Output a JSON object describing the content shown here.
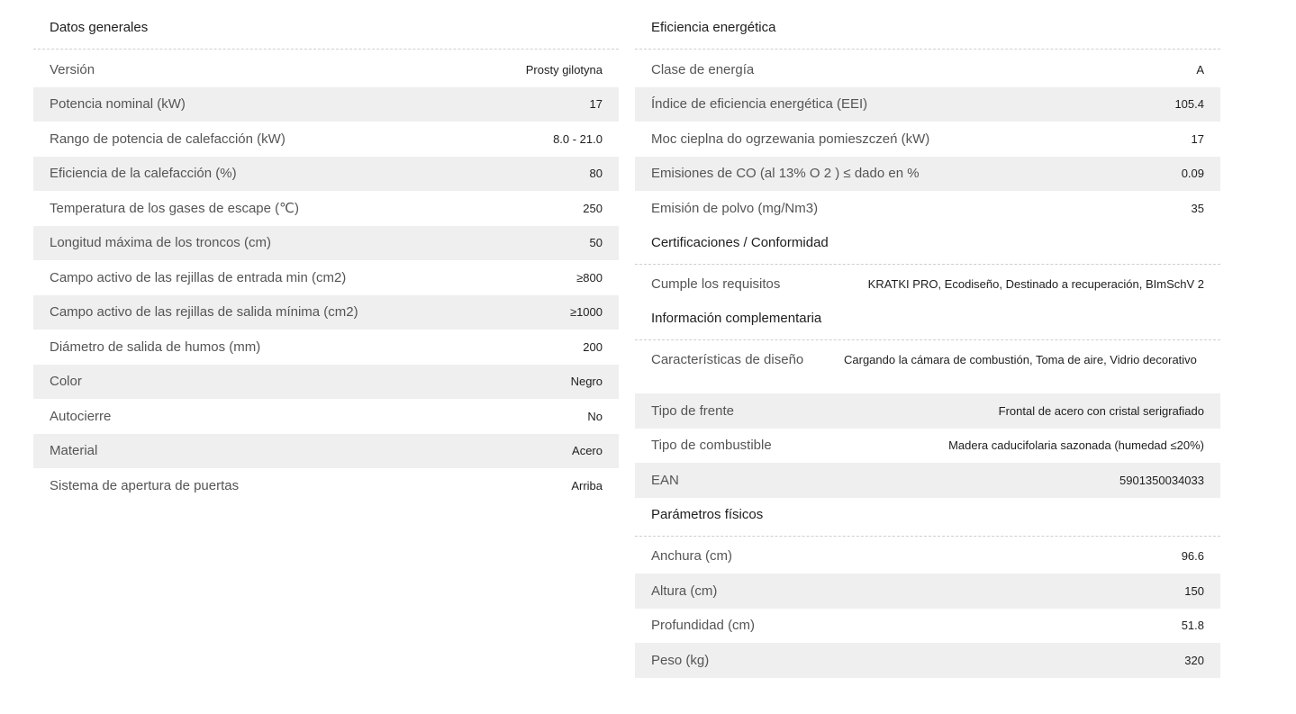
{
  "general": {
    "title": "Datos generales",
    "rows": [
      {
        "label": "Versión",
        "value": "Prosty gilotyna"
      },
      {
        "label": "Potencia nominal (kW)",
        "value": "17"
      },
      {
        "label": "Rango de potencia de calefacción (kW)",
        "value": "8.0 - 21.0"
      },
      {
        "label": "Eficiencia de la calefacción (%)",
        "value": "80"
      },
      {
        "label": "Temperatura de los gases de escape (℃)",
        "value": "250"
      },
      {
        "label": "Longitud máxima de los troncos (cm)",
        "value": "50"
      },
      {
        "label": "Campo activo de las rejillas de entrada min (cm2)",
        "value": "≥800"
      },
      {
        "label": "Campo activo de las rejillas de salida mínima (cm2)",
        "value": "≥1000"
      },
      {
        "label": "Diámetro de salida de humos (mm)",
        "value": "200"
      },
      {
        "label": "Color",
        "value": "Negro"
      },
      {
        "label": "Autocierre",
        "value": "No"
      },
      {
        "label": "Material",
        "value": "Acero"
      },
      {
        "label": "Sistema de apertura de puertas",
        "value": "Arriba"
      }
    ]
  },
  "energy": {
    "title": "Eficiencia energética",
    "rows": [
      {
        "label": "Clase de energía",
        "value": "A"
      },
      {
        "label": "Índice de eficiencia energética (EEI)",
        "value": "105.4"
      },
      {
        "label": "Moc cieplna do ogrzewania pomieszczeń (kW)",
        "value": "17"
      },
      {
        "label": "Emisiones de CO (al 13% O 2 ) ≤ dado en %",
        "value": "0.09"
      },
      {
        "label": "Emisión de polvo (mg/Nm3)",
        "value": "35"
      }
    ]
  },
  "certifications": {
    "title": "Certificaciones / Conformidad",
    "rows": [
      {
        "label": "Cumple los requisitos",
        "value": "KRATKI PRO, Ecodiseño, Destinado a recuperación, BImSchV 2"
      }
    ]
  },
  "complementary": {
    "title": "Información complementaria",
    "rows": [
      {
        "label": "Características de diseño",
        "value": "Cargando la cámara de combustión, Toma de aire, Vidrio decorativo"
      },
      {
        "label": "Tipo de frente",
        "value": "Frontal de acero con cristal serigrafiado"
      },
      {
        "label": "Tipo de combustible",
        "value": "Madera caducifolaria sazonada (humedad ≤20%)"
      },
      {
        "label": "EAN",
        "value": "5901350034033"
      }
    ]
  },
  "physical": {
    "title": "Parámetros físicos",
    "rows": [
      {
        "label": "Anchura (cm)",
        "value": "96.6"
      },
      {
        "label": "Altura (cm)",
        "value": "150"
      },
      {
        "label": "Profundidad (cm)",
        "value": "51.8"
      },
      {
        "label": "Peso (kg)",
        "value": "320"
      }
    ]
  }
}
